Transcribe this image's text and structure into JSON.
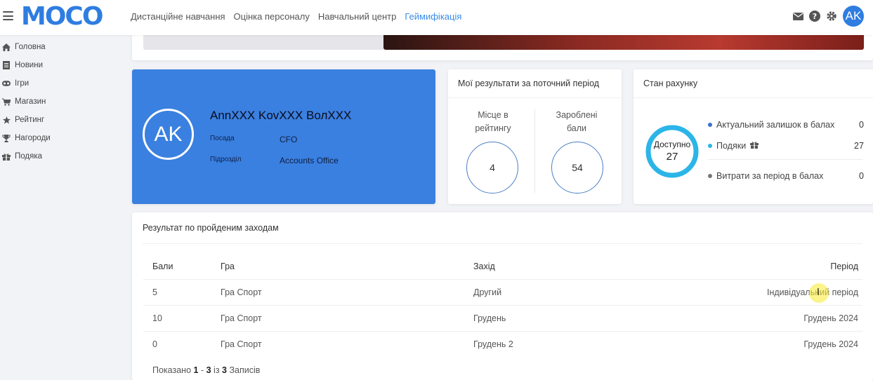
{
  "app": {
    "logo": "MOCO",
    "avatar_initials": "AK"
  },
  "topnav": [
    {
      "label": "Дистанційне навчання",
      "active": false
    },
    {
      "label": "Оцінка персоналу",
      "active": false
    },
    {
      "label": "Навчальний центр",
      "active": false
    },
    {
      "label": "Геймифікація",
      "active": true
    }
  ],
  "top_icons": [
    "envelope-icon",
    "question-icon",
    "gear-icon"
  ],
  "sidebar": {
    "items": [
      {
        "label": "Головна",
        "icon": "home-icon"
      },
      {
        "label": "Новини",
        "icon": "news-icon"
      },
      {
        "label": "Ігри",
        "icon": "gamepad-icon"
      },
      {
        "label": "Магазин",
        "icon": "cart-icon"
      },
      {
        "label": "Рейтинг",
        "icon": "star-icon"
      },
      {
        "label": "Нагороди",
        "icon": "trophy-icon"
      },
      {
        "label": "Подяка",
        "icon": "gift-icon"
      }
    ]
  },
  "profile": {
    "initials": "AK",
    "name": "AnnXXX KovXXX ВолXXX",
    "position_label": "Посада",
    "position_value": "CFO",
    "department_label": "Підрозділ",
    "department_value": "Accounts Office"
  },
  "results": {
    "title": "Мої результати за поточний період",
    "place_label": "Місце в рейтингу",
    "place_value": "4",
    "earned_label": "Зароблені бали",
    "earned_value": "54"
  },
  "account": {
    "title": "Стан рахунку",
    "donut_label": "Доступно",
    "donut_value": "27",
    "legend": [
      {
        "label": "Актуальний залишок в балах",
        "value": "0",
        "color": "#3a6fd0"
      },
      {
        "label": "Подяки",
        "value": "27",
        "color": "#2bb5e8"
      },
      {
        "label": "Витрати за період в балах",
        "value": "0",
        "color": "#777777"
      }
    ]
  },
  "events": {
    "title": "Результат по пройденим заходам",
    "columns": [
      "Бали",
      "Гра",
      "Захід",
      "Період"
    ],
    "rows": [
      [
        "5",
        "Гра Спорт",
        "Другий",
        "Індивідуальний період"
      ],
      [
        "10",
        "Гра Спорт",
        "Грудень",
        "Грудень 2024"
      ],
      [
        "0",
        "Гра Спорт",
        "Грудень 2",
        "Грудень 2024"
      ]
    ],
    "footer": {
      "prefix": "Показано",
      "from": "1",
      "dash": "-",
      "to": "3",
      "of": "із",
      "total": "3",
      "suffix": "Записів"
    }
  },
  "colors": {
    "brand": "#2f7de1",
    "profile_bg": "#3a80e0",
    "donut": "#2bb5e8"
  }
}
